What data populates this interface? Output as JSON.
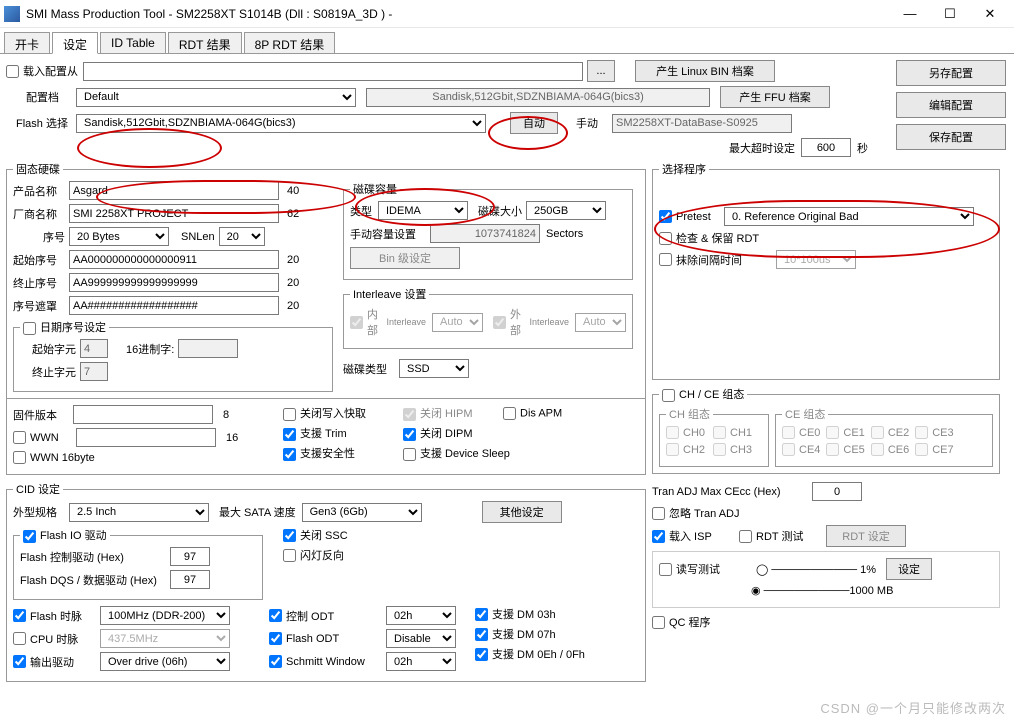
{
  "window": {
    "title": "SMI Mass Production Tool          - SM2258XT    S1014B     (Dll : S0819A_3D ) -",
    "min": "—",
    "max": "☐",
    "close": "✕"
  },
  "tabs": [
    "开卡",
    "设定",
    "ID Table",
    "RDT 结果",
    "8P RDT 结果"
  ],
  "top": {
    "load_from": "载入配置从",
    "browse": "...",
    "gen_linux": "产生 Linux BIN 档案",
    "gen_ffu": "产生 FFU 档案",
    "save_as": "另存配置",
    "edit_cfg": "编辑配置",
    "save_cfg": "保存配置",
    "profile_lbl": "配置档",
    "profile": "Default",
    "desc": "Sandisk,512Gbit,SDZNBIAMA-064G(bics3)",
    "flash_sel_lbl": "Flash 选择",
    "flash_sel": "Sandisk,512Gbit,SDZNBIAMA-064G(bics3)",
    "auto": "自动",
    "manual": "手动",
    "db": "SM2258XT-DataBase-S0925",
    "max_over_lbl": "最大超时设定",
    "max_over": "600",
    "sec": "秒"
  },
  "ssd": {
    "legend": "固态硬碟",
    "prod_name_lbl": "产品名称",
    "prod_name": "Asgard",
    "pn_len": "40",
    "vendor_lbl": "厂商名称",
    "vendor": "SMI 2258XT PROJECT",
    "vn_len": "62",
    "serial_lbl": "序号",
    "serial": "20 Bytes",
    "snlen_lbl": "SNLen",
    "snlen": "20",
    "start_lbl": "起始序号",
    "start": "AA000000000000000911",
    "start_len": "20",
    "end_lbl": "终止序号",
    "end": "AA999999999999999999",
    "end_len": "20",
    "mask_lbl": "序号遮罩",
    "mask": "AA##################",
    "mask_len": "20",
    "date_legend": "日期序号设定",
    "sc_lbl": "起始字元",
    "sc": "4",
    "hex_lbl": "16进制字:",
    "hex": "",
    "ec_lbl": "终止字元",
    "ec": "7"
  },
  "cap": {
    "legend": "磁碟容量",
    "type_lbl": "类型",
    "type": "IDEMA",
    "size_lbl": "磁碟大小",
    "size": "250GB",
    "manual_lbl": "手动容量设置",
    "sectors": "1073741824",
    "unit": "Sectors",
    "bin_btn": "Bin 级设定"
  },
  "interleave": {
    "legend": "Interleave 设置",
    "inner": "内部",
    "outer": "外部",
    "sub": "Interleave",
    "auto": "Auto",
    "disk_type_lbl": "磁碟类型",
    "disk_type": "SSD"
  },
  "fw": {
    "ver_lbl": "固件版本",
    "ver": "",
    "ver_len": "8",
    "wwn": "WWN",
    "wwn_len": "16",
    "wwn16": "WWN 16byte",
    "close_wr": "关闭写入快取",
    "close_hipm": "关闭 HIPM",
    "dis_apm": "Dis APM",
    "trim": "支援 Trim",
    "close_dipm": "关闭 DIPM",
    "safe": "支援安全性",
    "dev_sleep": "支援 Device Sleep"
  },
  "cid": {
    "legend": "CID 设定",
    "form_lbl": "外型规格",
    "form": "2.5 Inch",
    "sata_lbl": "最大 SATA 速度",
    "sata": "Gen3 (6Gb)",
    "other": "其他设定",
    "flash_io": "Flash IO 驱动",
    "ctrl_lbl": "Flash 控制驱动 (Hex)",
    "ctrl": "97",
    "dqs_lbl": "Flash DQS / 数据驱动 (Hex)",
    "dqs": "97",
    "close_ssc": "关闭 SSC",
    "lamp": "闪灯反向",
    "flash_clk": "Flash 时脉",
    "flash_clk_v": "100MHz (DDR-200)",
    "cpu_clk": "CPU 时脉",
    "cpu_clk_v": "437.5MHz",
    "out_drv": "输出驱动",
    "out_drv_v": "Over drive (06h)",
    "ctrl_odt": "控制 ODT",
    "ctrl_odt_v": "02h",
    "flash_odt": "Flash ODT",
    "flash_odt_v": "Disable",
    "schmitt": "Schmitt Window",
    "schmitt_v": "02h",
    "dm03": "支援 DM 03h",
    "dm07": "支援 DM 07h",
    "dm0e": "支援 DM 0Eh / 0Fh"
  },
  "sel": {
    "legend": "选择程序",
    "pretest": "Pretest",
    "pretest_v": "0. Reference Original Bad",
    "check_rdt": "检查 & 保留 RDT",
    "erase_int": "抹除间隔时间",
    "erase_v": "10*100us"
  },
  "chce": {
    "legend": "CH / CE 组态",
    "ch_legend": "CH 组态",
    "ce_legend": "CE 组态",
    "ch": [
      "CH0",
      "CH1",
      "CH2",
      "CH3"
    ],
    "ce": [
      "CE0",
      "CE1",
      "CE2",
      "CE3",
      "CE4",
      "CE5",
      "CE6",
      "CE7"
    ]
  },
  "misc": {
    "tran_lbl": "Tran ADJ Max CEcc (Hex)",
    "tran": "0",
    "ignore": "忽略 Tran ADJ",
    "load_isp": "载入 ISP",
    "rdt_test": "RDT 测试",
    "rdt_set": "RDT 设定",
    "rw_test": "读写测试",
    "pct": "1%",
    "mb": "1000 MB",
    "set": "设定",
    "qc": "QC 程序"
  },
  "watermark": "CSDN @一个月只能修改两次"
}
